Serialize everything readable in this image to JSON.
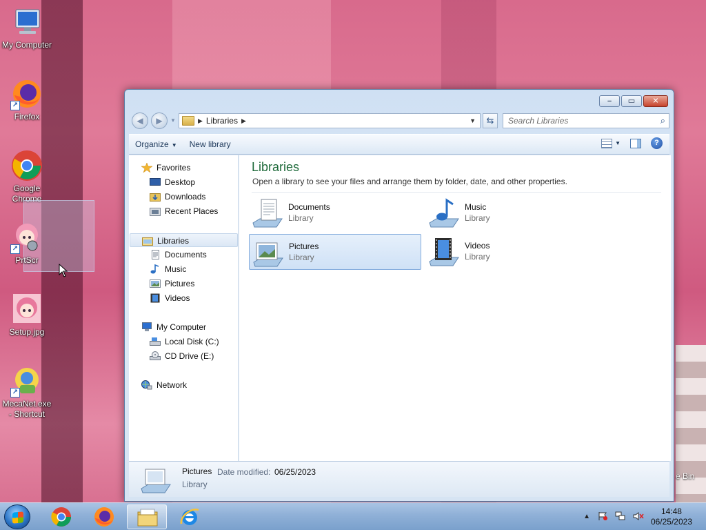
{
  "desktop": {
    "icons": [
      {
        "label": "My Computer"
      },
      {
        "label": "Firefox"
      },
      {
        "label": "Google Chrome"
      },
      {
        "label": "PrtScr"
      },
      {
        "label": "Setup.jpg"
      },
      {
        "label": "MecaNet.exe - Shortcut"
      }
    ],
    "partial_label": "e Bin"
  },
  "window": {
    "address": {
      "crumb": "Libraries"
    },
    "search": {
      "placeholder": "Search Libraries"
    },
    "toolbar": {
      "organize": "Organize",
      "new_library": "New library"
    },
    "nav": {
      "favorites": "Favorites",
      "desktop": "Desktop",
      "downloads": "Downloads",
      "recent_places": "Recent Places",
      "libraries": "Libraries",
      "documents": "Documents",
      "music": "Music",
      "pictures": "Pictures",
      "videos": "Videos",
      "my_computer": "My Computer",
      "local_disk": "Local Disk (C:)",
      "cd_drive": "CD Drive (E:)",
      "network": "Network"
    },
    "content": {
      "title": "Libraries",
      "subtitle": "Open a library to see your files and arrange them by folder, date, and other properties.",
      "libraries": [
        {
          "name": "Documents",
          "type": "Library"
        },
        {
          "name": "Music",
          "type": "Library"
        },
        {
          "name": "Pictures",
          "type": "Library"
        },
        {
          "name": "Videos",
          "type": "Library"
        }
      ]
    },
    "details": {
      "name": "Pictures",
      "date_label": "Date modified:",
      "date_value": "06/25/2023 ﻿",
      "type": "Library"
    }
  },
  "taskbar": {
    "time": "14:48",
    "date": "06/25/2023"
  }
}
